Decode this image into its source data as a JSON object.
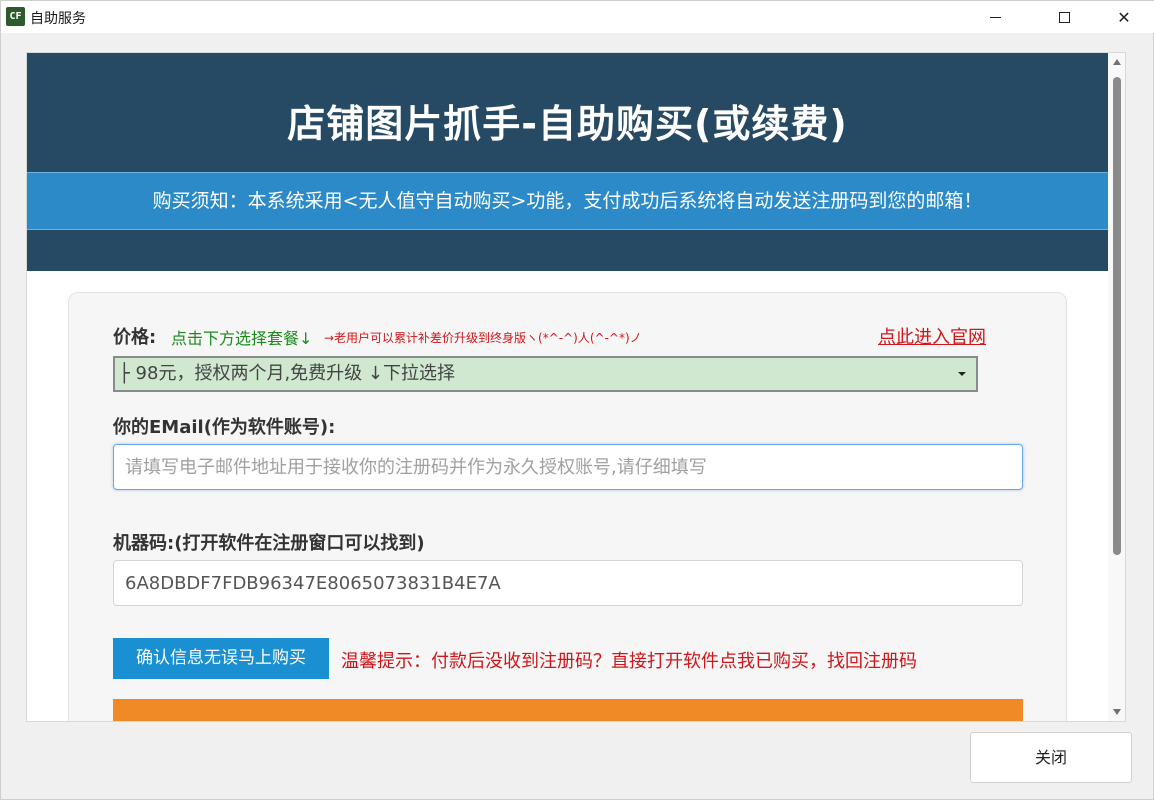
{
  "window": {
    "title": "自助服务",
    "icon_text": "CF"
  },
  "header": {
    "title": "店铺图片抓手-自助购买(或续费)",
    "notice": "购买须知：本系统采用<无人值守自动购买>功能，支付成功后系统将自动发送注册码到您的邮箱！"
  },
  "form": {
    "price_label": "价格:",
    "price_hint_green": "点击下方选择套餐↓",
    "price_hint_red": "→老用户可以累计补差价升级到终身版ヽ(*^-^)人(^-^*)ノ",
    "official_link": "点此进入官网",
    "plan_selected": "├ 98元，授权两个月,免费升级 ↓下拉选择",
    "email_label": "你的EMail(作为软件账号):",
    "email_placeholder": "请填写电子邮件地址用于接收你的注册码并作为永久授权账号,请仔细填写",
    "email_value": "",
    "machine_label": "机器码:(打开软件在注册窗口可以找到)",
    "machine_value": "6A8DBDF7FDB96347E8065073831B4E7A",
    "buy_button": "确认信息无误马上购买",
    "warm_tip": "温馨提示：付款后没收到注册码？直接打开软件点我已购买，找回注册码"
  },
  "footer": {
    "close_button": "关闭"
  },
  "colors": {
    "header_bg": "#264a63",
    "notice_bg": "#2b8ac7",
    "buy_button": "#1a8fd1",
    "orange_bar": "#f08a24",
    "select_bg": "#cfe8cf",
    "alert_red": "#d0161b",
    "hint_green": "#1c8a1c"
  },
  "icons": {
    "app": "cf-app-icon",
    "minimize": "minimize-icon",
    "maximize": "maximize-icon",
    "close": "close-icon",
    "select_caret": "caret-down-icon"
  }
}
